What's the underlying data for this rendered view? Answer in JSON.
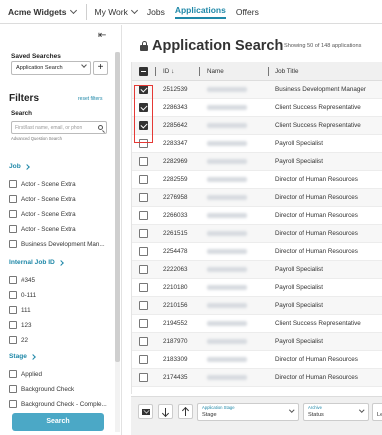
{
  "topbar": {
    "brand": "Acme Widgets",
    "nav": [
      {
        "label": "My Work",
        "has_chevron": true,
        "active": false
      },
      {
        "label": "Jobs",
        "active": false
      },
      {
        "label": "Applications",
        "active": true
      },
      {
        "label": "Offers",
        "active": false
      }
    ]
  },
  "sidebar": {
    "collapse_icon": "collapse-left-icon",
    "saved_searches_label": "Saved Searches",
    "saved_search_value": "Application Search",
    "add_label": "+",
    "filters_title": "Filters",
    "reset_label": "reset filters",
    "search_label": "Search",
    "search_placeholder": "First/last name, email, or phon",
    "advanced_label": "Advanced Question Search",
    "sections": [
      {
        "title": "Job",
        "items": [
          "Actor - Scene Extra",
          "Actor - Scene Extra",
          "Actor - Scene Extra",
          "Actor - Scene Extra",
          "Business Development Man..."
        ]
      },
      {
        "title": "Internal Job ID",
        "items": [
          "#345",
          "0-111",
          "111",
          "123",
          "22"
        ]
      },
      {
        "title": "Stage",
        "items": [
          "Applied",
          "Background Check",
          "Background Check - Comple..."
        ]
      }
    ],
    "search_button": "Search"
  },
  "main": {
    "title": "Application Search",
    "showing": "Showing 50 of 148 applications",
    "columns": {
      "id": "ID",
      "name": "Name",
      "job": "Job Title"
    },
    "rows": [
      {
        "id": "2512539",
        "job": "Business Development Manager",
        "checked": true
      },
      {
        "id": "2286343",
        "job": "Client Success Representative",
        "checked": true
      },
      {
        "id": "2285642",
        "job": "Client Success Representative",
        "checked": true
      },
      {
        "id": "2283347",
        "job": "Payroll Specialist",
        "checked": false
      },
      {
        "id": "2282969",
        "job": "Payroll Specialist",
        "checked": false
      },
      {
        "id": "2282559",
        "job": "Director of Human Resources",
        "checked": false
      },
      {
        "id": "2276958",
        "job": "Director of Human Resources",
        "checked": false
      },
      {
        "id": "2266033",
        "job": "Director of Human Resources",
        "checked": false
      },
      {
        "id": "2261515",
        "job": "Director of Human Resources",
        "checked": false
      },
      {
        "id": "2254478",
        "job": "Director of Human Resources",
        "checked": false
      },
      {
        "id": "2222063",
        "job": "Payroll Specialist",
        "checked": false
      },
      {
        "id": "2210180",
        "job": "Payroll Specialist",
        "checked": false
      },
      {
        "id": "2210156",
        "job": "Payroll Specialist",
        "checked": false
      },
      {
        "id": "2194552",
        "job": "Client Success Representative",
        "checked": false
      },
      {
        "id": "2187970",
        "job": "Payroll Specialist",
        "checked": false
      },
      {
        "id": "2183309",
        "job": "Director of Human Resources",
        "checked": false
      },
      {
        "id": "2174435",
        "job": "Director of Human Resources",
        "checked": false
      }
    ]
  },
  "bottom": {
    "stage_label": "Application Stage",
    "stage_value": "Stage",
    "archive_label": "Archive",
    "archive_value": "Status",
    "third_value": "Le"
  },
  "colors": {
    "accent": "#1f88a8",
    "search_button": "#4ba8c6",
    "highlight": "#e53935"
  }
}
